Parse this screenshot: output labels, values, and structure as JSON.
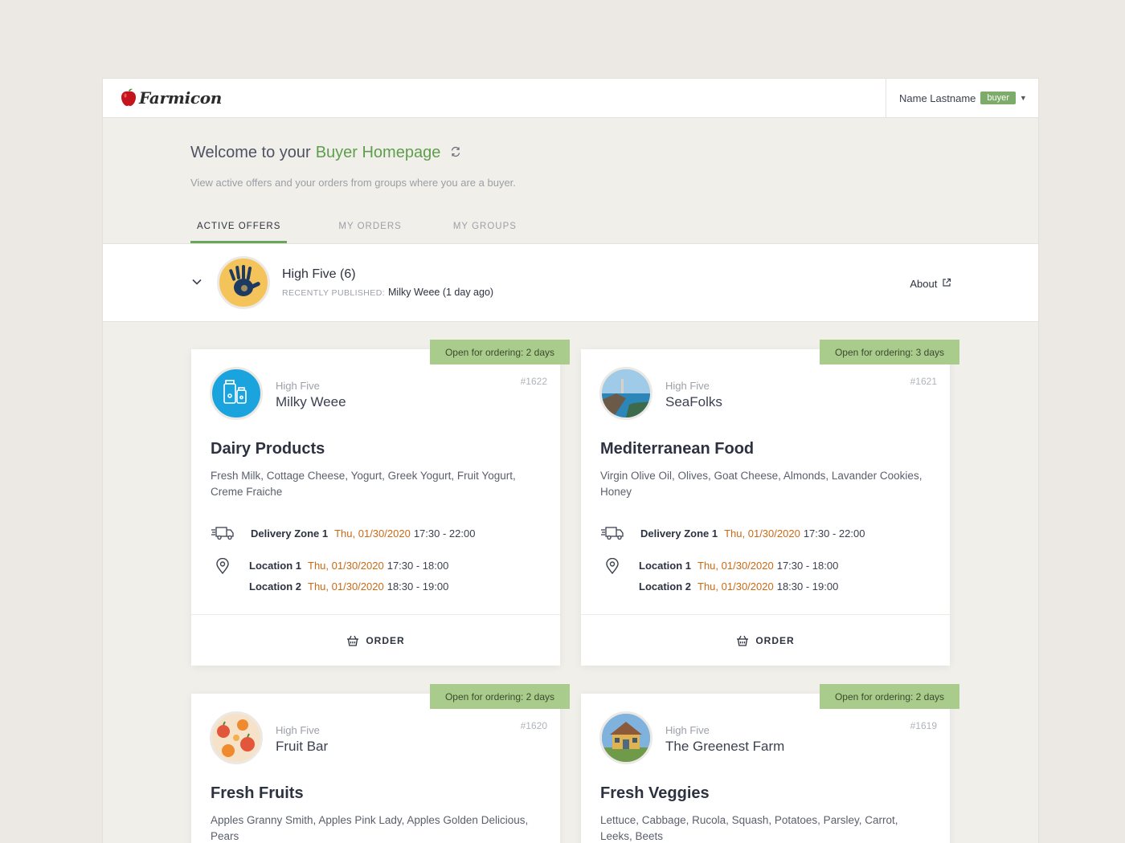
{
  "app": {
    "name": "Farmicon"
  },
  "user": {
    "name": "Name Lastname",
    "role": "buyer"
  },
  "header": {
    "welcome_prefix": "Welcome to your",
    "welcome_accent": "Buyer Homepage",
    "subtitle": "View active offers and your orders from groups where you are a buyer."
  },
  "tabs": [
    {
      "label": "ACTIVE OFFERS",
      "active": true
    },
    {
      "label": "MY ORDERS",
      "active": false
    },
    {
      "label": "MY GROUPS",
      "active": false
    }
  ],
  "group": {
    "name": "High Five (6)",
    "recent_label": "RECENTLY PUBLISHED:",
    "recent_value": "Milky Weee (1 day ago)",
    "about_label": "About"
  },
  "offers": [
    {
      "ribbon": "Open for ordering: 2 days",
      "group": "High Five",
      "seller": "Milky Weee",
      "id": "#1622",
      "title": "Dairy Products",
      "description": "Fresh Milk, Cottage Cheese, Yogurt, Greek Yogurt, Fruit Yogurt, Creme Fraiche",
      "delivery": {
        "name": "Delivery Zone 1",
        "date": "Thu, 01/30/2020",
        "time": "17:30 - 22:00"
      },
      "locations": [
        {
          "name": "Location 1",
          "date": "Thu, 01/30/2020",
          "time": "17:30 - 18:00"
        },
        {
          "name": "Location 2",
          "date": "Thu, 01/30/2020",
          "time": "18:30 - 19:00"
        }
      ],
      "order_label": "ORDER",
      "avatar_icon": "milk-bottles-icon"
    },
    {
      "ribbon": "Open for ordering: 3 days",
      "group": "High Five",
      "seller": "SeaFolks",
      "id": "#1621",
      "title": "Mediterranean Food",
      "description": "Virgin Olive Oil, Olives, Goat Cheese, Almonds, Lavander Cookies, Honey",
      "delivery": {
        "name": "Delivery Zone 1",
        "date": "Thu, 01/30/2020",
        "time": "17:30 - 22:00"
      },
      "locations": [
        {
          "name": "Location 1",
          "date": "Thu, 01/30/2020",
          "time": "17:30 - 18:00"
        },
        {
          "name": "Location 2",
          "date": "Thu, 01/30/2020",
          "time": "18:30 - 19:00"
        }
      ],
      "order_label": "ORDER",
      "avatar_icon": "seaside-photo"
    },
    {
      "ribbon": "Open for ordering: 2 days",
      "group": "High Five",
      "seller": "Fruit Bar",
      "id": "#1620",
      "title": "Fresh Fruits",
      "description": "Apples Granny Smith, Apples Pink Lady, Apples Golden Delicious, Pears",
      "avatar_icon": "fruit-pattern"
    },
    {
      "ribbon": "Open for ordering: 2 days",
      "group": "High Five",
      "seller": "The Greenest Farm",
      "id": "#1619",
      "title": "Fresh Veggies",
      "description": "Lettuce, Cabbage, Rucola, Squash, Potatoes, Parsley, Carrot, Leeks, Beets",
      "avatar_icon": "farmhouse-photo"
    }
  ],
  "colors": {
    "accent_green": "#5f9e4e",
    "ribbon_green": "#a9cc8c",
    "date_orange": "#c96a15",
    "background": "#ece9e4"
  }
}
